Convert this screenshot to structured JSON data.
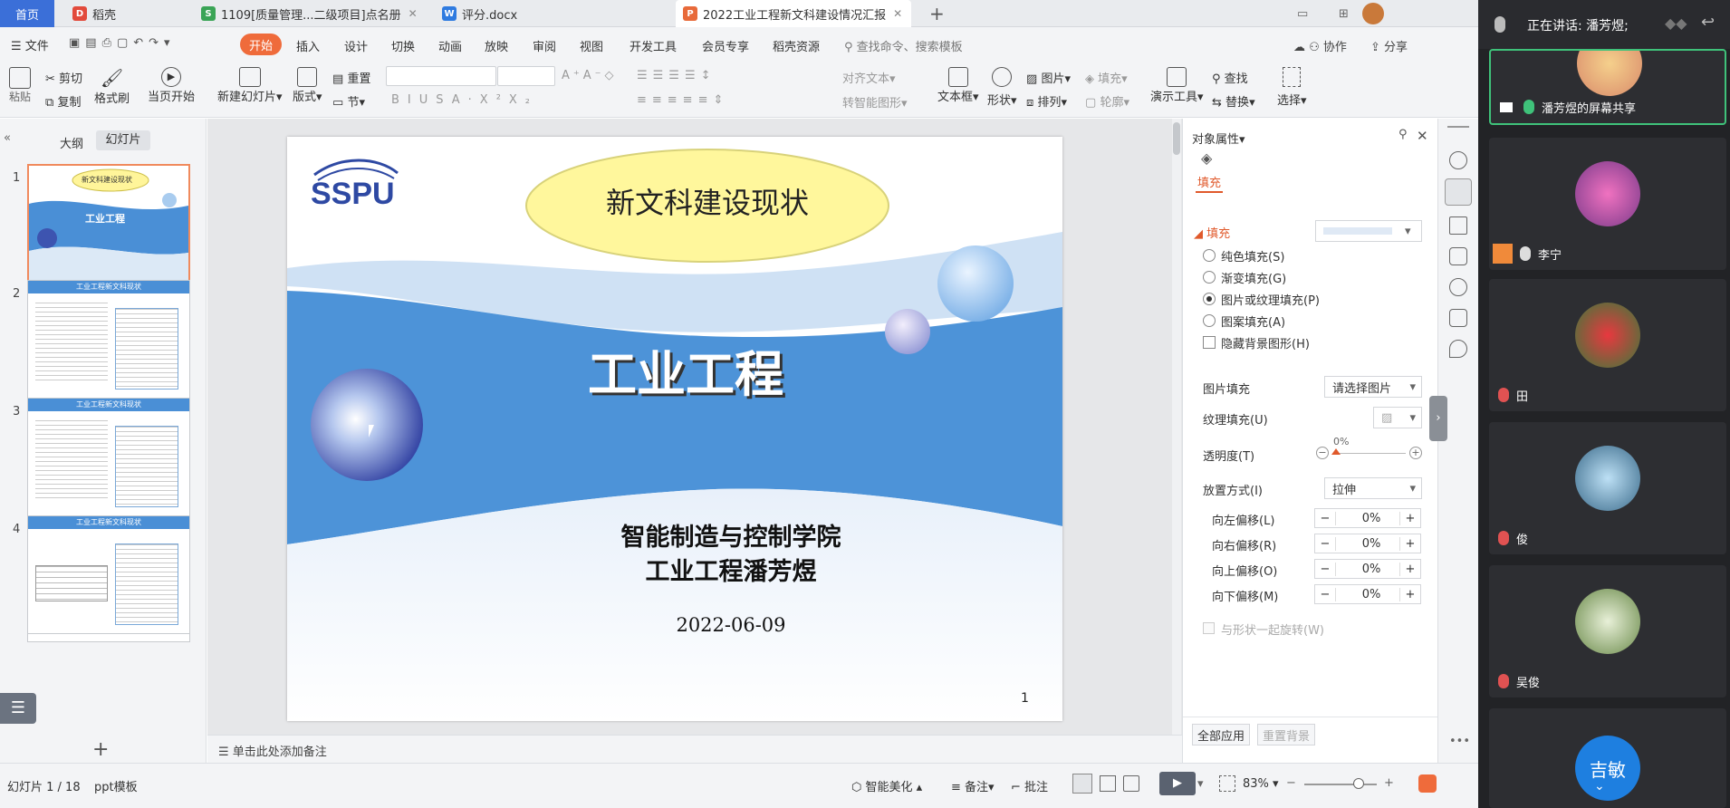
{
  "tabs": [
    {
      "label": "首页"
    },
    {
      "label": "稻壳"
    },
    {
      "label": "1109[质量管理...二级项目]点名册"
    },
    {
      "label": "评分.docx"
    },
    {
      "label": "2022工业工程新文科建设情况汇报"
    }
  ],
  "menu": {
    "file": "文件",
    "items": [
      "开始",
      "插入",
      "设计",
      "切换",
      "动画",
      "放映",
      "审阅",
      "视图",
      "开发工具",
      "会员专享",
      "稻壳资源"
    ],
    "search": "查找命令、搜索模板",
    "collab": "协作",
    "share": "分享"
  },
  "ribbon": {
    "paste": "粘贴",
    "cut": "剪切",
    "copy": "复制",
    "format_painter": "格式刷",
    "from_current": "当页开始",
    "new_slide": "新建幻灯片",
    "layout": "版式",
    "section": "节",
    "reset": "重置",
    "align_text": "对齐文本",
    "smart_shape": "转智能图形",
    "textbox": "文本框",
    "shape": "形状",
    "picture": "图片",
    "arrange": "排列",
    "fill": "填充",
    "outline": "轮廓",
    "present_tools": "演示工具",
    "find": "查找",
    "replace": "替换",
    "select": "选择"
  },
  "left_panel": {
    "tab_outline": "大纲",
    "tab_slides": "幻灯片",
    "slide_numbers": [
      "1",
      "2",
      "3",
      "4"
    ],
    "t1_title": "新文科建设现状",
    "t1_main": "工业工程",
    "t2_title": "工业工程新文科现状",
    "t3_title": "工业工程新文科现状",
    "t4_title": "工业工程新文科现状"
  },
  "slide": {
    "logo": "SSPU",
    "title": "新文科建设现状",
    "main": "工业工程",
    "college": "智能制造与控制学院",
    "author": "工业工程潘芳煜",
    "date": "2022-06-09",
    "page": "1"
  },
  "notes_placeholder": "单击此处添加备注",
  "props": {
    "header": "对象属性",
    "tab_fill": "填充",
    "section_fill": "填充",
    "solid": "纯色填充(S)",
    "gradient": "渐变填充(G)",
    "picture_texture": "图片或纹理填充(P)",
    "pattern": "图案填充(A)",
    "hide_bg": "隐藏背景图形(H)",
    "picture_fill": "图片填充",
    "picture_fill_value": "请选择图片",
    "texture_fill": "纹理填充(U)",
    "transparency": "透明度(T)",
    "transparency_value": "0%",
    "placement": "放置方式(I)",
    "placement_value": "拉伸",
    "offset_left": "向左偏移(L)",
    "offset_right": "向右偏移(R)",
    "offset_up": "向上偏移(O)",
    "offset_down": "向下偏移(M)",
    "offset_value": "0%",
    "rotate_with_shape": "与形状一起旋转(W)",
    "apply_all": "全部应用",
    "reset_bg": "重置背景"
  },
  "status": {
    "slide_counter": "幻灯片 1 / 18",
    "template": "ppt模板",
    "smart_beautify": "智能美化",
    "notes": "备注",
    "comments": "批注",
    "zoom": "83%"
  },
  "meeting": {
    "speaking_label": "正在讲话: 潘芳煜;",
    "participants": [
      {
        "name": "潘芳煜的屏幕共享"
      },
      {
        "name": "李宁"
      },
      {
        "name": "田"
      },
      {
        "name": "俊"
      },
      {
        "name": "吴俊"
      },
      {
        "name": "吉敏"
      }
    ]
  }
}
